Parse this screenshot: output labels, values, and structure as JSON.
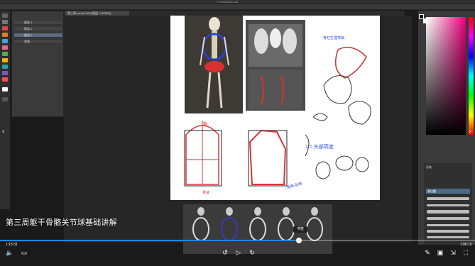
{
  "window": {
    "clock": "7-9-20230311-20"
  },
  "menubar": {
    "items": [
      "文件",
      "编辑",
      "图像",
      "图层",
      "文字",
      "选择",
      "滤镜",
      "3D",
      "视图",
      "增效工具",
      "窗口",
      "帮助"
    ]
  },
  "document": {
    "tab": "第三周 psd @ 50%(图层 1,RGB/8)"
  },
  "layers": {
    "items": [
      "图层 3",
      "图层 2",
      "图层 1",
      "背景"
    ]
  },
  "video": {
    "subtitle": "第三周躯干骨骼关节球基础讲解",
    "time_current": "1:15:31",
    "time_total": "1:06:15",
    "progress": 0.63,
    "hover_tooltip": "书签",
    "progress_color": "#1e88e5"
  },
  "artboard": {
    "annotation_top": "脊柱生理弯曲",
    "annotation_mid": "1 = 头部高度",
    "annotation_low": "骶骨-肋骨",
    "label_left": "胸",
    "label_bottom": "骨盆"
  },
  "brushes": {
    "panel_label": "画笔",
    "selected": "柔边圆"
  }
}
